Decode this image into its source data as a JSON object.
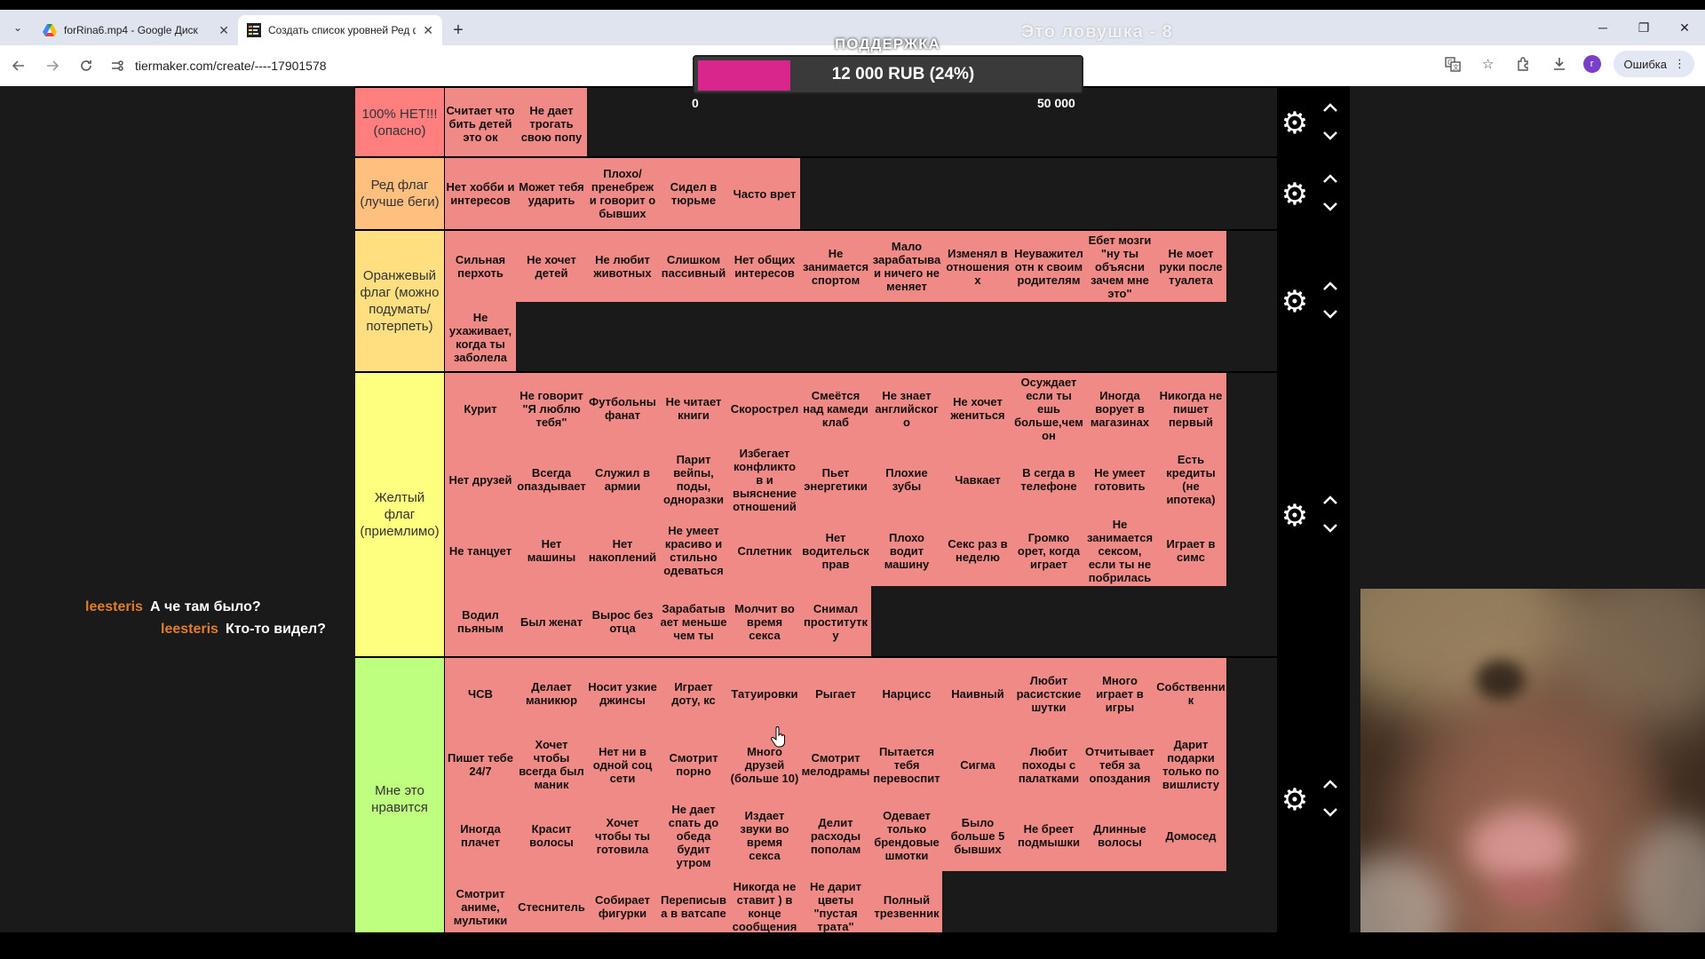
{
  "browser": {
    "tabs": [
      {
        "label": "forRina6.mp4 - Google Диск",
        "active": false
      },
      {
        "label": "Создать список уровней Ред ф",
        "active": true
      }
    ],
    "url": "tiermaker.com/create/----17901578",
    "error_label": "Ошибка",
    "avatar_letter": "r"
  },
  "overlay": {
    "trap_title": "Это ловушка - 8",
    "support_label": "ПОДДЕРЖКА",
    "donation_text": "12 000 RUB (24%)",
    "donation_fraction": 0.24,
    "scale_min": "0",
    "scale_max": "50 000",
    "fill_color": "#d8268c"
  },
  "tiers": [
    {
      "label": "100% НЕТ!!! (опасно)",
      "color": "#ff7f7f",
      "items": [
        "Считает что бить детей это ок",
        "Не дает трогать свою попу"
      ]
    },
    {
      "label": "Ред флаг (лучше беги)",
      "color": "#ffbf7f",
      "items": [
        "Нет хобби и интересов",
        "Может тебя ударить",
        "Плохо/ пренебрежи говорит о бывших",
        "Сидел в тюрьме",
        "Часто врет"
      ]
    },
    {
      "label": "Оранжевый флаг (можно подумать/ потерпеть)",
      "color": "#ffdf7f",
      "items": [
        "Сильная перхоть",
        "Не хочет детей",
        "Не любит животных",
        "Слишком пассивный",
        "Нет общих интересов",
        "Не занимается спортом",
        "Мало зарабатыва и ничего не меняет",
        "Изменял в отношениях",
        "Неуважител отн к своим родителям",
        "Ебет мозги \"ну ты объясни зачем мне это\"",
        "Не моет руки после туалета",
        "Не ухаживает, когда ты заболела"
      ]
    },
    {
      "label": "Желтый флаг (приемлимо)",
      "color": "#ffff7f",
      "items": [
        "Курит",
        "Не говорит \"Я люблю тебя\"",
        "Футбольны фанат",
        "Не читает книги",
        "Скорострел",
        "Смеётся над камеди клаб",
        "Не знает английского",
        "Не хочет жениться",
        "Осуждает если ты ешь больше,чем он",
        "Иногда ворует в магазинах",
        "Никогда не пишет первый",
        "Нет друзей",
        "Всегда опаздывает",
        "Служил в армии",
        "Парит вейпы, поды, одноразки",
        "Избегает конфликтов и выяснение отношений",
        "Пьет энергетики",
        "Плохие зубы",
        "Чавкает",
        "В сегда в телефоне",
        "Не умеет готовить",
        "Есть кредиты (не ипотека)",
        "Не танцует",
        "Нет машины",
        "Нет накоплений",
        "Не умеет красиво и стильно одеваться",
        "Сплетник",
        "Нет водительск прав",
        "Плохо водит машину",
        "Секс раз в неделю",
        "Громко орет, когда играет",
        "Не занимается сексом, если ты не побрилась",
        "Играет в симс",
        "Водил пьяным",
        "Был женат",
        "Вырос без отца",
        "Зарабатывает меньше чем ты",
        "Молчит во время секса",
        "Снимал проститутку"
      ]
    },
    {
      "label": "Мне это нравится",
      "color": "#bfff7f",
      "items": [
        "ЧСВ",
        "Делает маникюр",
        "Носит узкие джинсы",
        "Играет доту, кс",
        "Татуировки",
        "Рыгает",
        "Нарцисс",
        "Наивный",
        "Любит расистские шутки",
        "Много играет в игры",
        "Собственник",
        "Пишет тебе 24/7",
        "Хочет чтобы всегда был маник",
        "Нет ни в одной соц сети",
        "Смотрит порно",
        "Много друзей (больше 10)",
        "Смотрит мелодрамы",
        "Пытается тебя перевоспит",
        "Сигма",
        "Любит походы с палатками",
        "Отчитывает тебя за опоздания",
        "Дарит подарки только по вишлисту",
        "Иногда плачет",
        "Красит волосы",
        "Хочет чтобы ты готовила",
        "Не дает спать до обеда будит утром",
        "Издает звуки во время секса",
        "Делит расходы пополам",
        "Одевает только брендовые шмотки",
        "Было больше 5 бывших",
        "Не бреет подмышки",
        "Длинные волосы",
        "Домосед",
        "Смотрит аниме, мультики",
        "Стеснитель",
        "Собирает фигурки",
        "Переписыва в ватсапе",
        "Никогда не ставит ) в конце сообщения",
        "Не дарит цветы \"пустая трата\"",
        "Полный трезвенник"
      ]
    }
  ],
  "chat": [
    {
      "user": "leesteris",
      "message": "А че там было?"
    },
    {
      "user": "leesteris",
      "message": "Кто-то видел?"
    }
  ]
}
